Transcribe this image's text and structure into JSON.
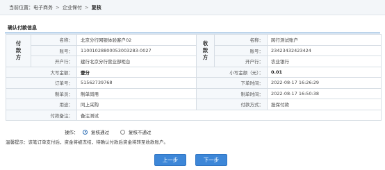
{
  "breadcrumb": {
    "prefix": "当前位置：",
    "items": [
      "电子商务",
      "企业保付",
      "复核"
    ],
    "separator": ">"
  },
  "section_title": "确认付款信息",
  "payer": {
    "side_label": "付款方",
    "name_label": "名称：",
    "name": "北京分行网银体验客户02",
    "account_label": "账号：",
    "account": "11001028800053003283-0027",
    "bank_label": "开户行：",
    "bank": "建行北京分行营业部柜台"
  },
  "payee": {
    "side_label": "收款方",
    "name_label": "名称：",
    "name": "跨行测试账户",
    "account_label": "账号：",
    "account": "23423432423424",
    "bank_label": "开户行：",
    "bank": "农业银行"
  },
  "details": {
    "amount_cn_label": "大写金额：",
    "amount_cn": "壹分",
    "amount_label": "小写金额（元）：",
    "amount": "0.01",
    "order_no_label": "订单号：",
    "order_no": "51562739768",
    "order_time_label": "下单时间：",
    "order_time": "2022-08-17 16:26:29",
    "maker_label": "制单员：",
    "maker": "制单岗用",
    "make_time_label": "制单时间：",
    "make_time": "2022-08-17 16:50:38",
    "purpose_label": "用途：",
    "purpose": "同上采购",
    "pay_method_label": "付款方式：",
    "pay_method": "担保付款",
    "remark_label": "付款备注：",
    "remark": "备注测试"
  },
  "operation": {
    "label": "操作：",
    "approve": "复核通过",
    "reject": "复核不通过",
    "selected": "approve"
  },
  "tip": "温馨提示：该笔订单支付后，资金将被冻结，待确认付款后资金将转至收款账户。",
  "buttons": {
    "prev": "上一步",
    "next": "下一步"
  },
  "colors": {
    "accent": "#3d87d8",
    "label_bg": "#f5f8fb",
    "border": "#d6dde4"
  }
}
